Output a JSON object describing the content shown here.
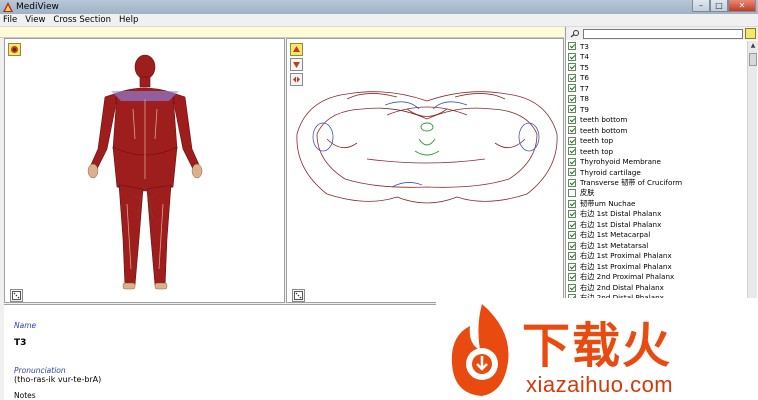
{
  "window": {
    "title": "MediView"
  },
  "menu": [
    "File",
    "View",
    "Cross Section",
    "Help"
  ],
  "search": {
    "value": "",
    "placeholder": ""
  },
  "structures": [
    {
      "label": "T3",
      "checked": true
    },
    {
      "label": "T4",
      "checked": true
    },
    {
      "label": "T5",
      "checked": true
    },
    {
      "label": "T6",
      "checked": true
    },
    {
      "label": "T7",
      "checked": true
    },
    {
      "label": "T8",
      "checked": true
    },
    {
      "label": "T9",
      "checked": true
    },
    {
      "label": "teeth bottom",
      "checked": true
    },
    {
      "label": "teeth bottom",
      "checked": true
    },
    {
      "label": "teeth top",
      "checked": true
    },
    {
      "label": "teeth top",
      "checked": true
    },
    {
      "label": "Thyrohyoid Membrane",
      "checked": true
    },
    {
      "label": "Thyroid cartilage",
      "checked": true
    },
    {
      "label": "Transverse 韧带 of Cruciform",
      "checked": true
    },
    {
      "label": "皮肤",
      "checked": false
    },
    {
      "label": "韧带um Nuchae",
      "checked": true
    },
    {
      "label": "右边 1st Distal Phalanx",
      "checked": true
    },
    {
      "label": "右边 1st Distal Phalanx",
      "checked": true
    },
    {
      "label": "右边 1st Metacarpal",
      "checked": true
    },
    {
      "label": "右边 1st Metatarsal",
      "checked": true
    },
    {
      "label": "右边 1st Proximal Phalanx",
      "checked": true
    },
    {
      "label": "右边 1st Proximal Phalanx",
      "checked": true
    },
    {
      "label": "右边 2nd  Proximal Phalanx",
      "checked": true
    },
    {
      "label": "右边 2nd Distal Phalanx",
      "checked": true
    },
    {
      "label": "右边 2nd Distal Phalanx",
      "checked": true
    }
  ],
  "info": {
    "name_label": "Name",
    "name_value": "T3",
    "pronunciation_label": "Pronunciation",
    "pronunciation_value": "(tho-ras-ik vur-te-brA)",
    "notes_label": "Notes"
  },
  "watermark": {
    "brand": "下载火",
    "url": "xiazaihuo.com"
  },
  "colors": {
    "accent": "#f5e76e",
    "label_blue": "#2a43a8",
    "muscle": "#9e1d1d",
    "watermark": "#e84a10"
  }
}
